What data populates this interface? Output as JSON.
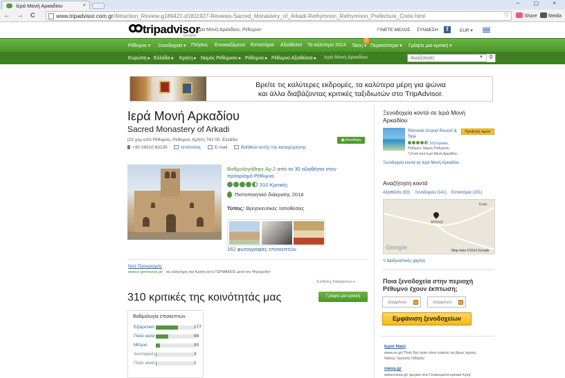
{
  "browser": {
    "tab_title": "Ιερά Μονή Αρκαδίου",
    "tab_close": "×",
    "url_host": "www.tripadvisor.com.gr",
    "url_path": "/Attraction_Review-g189421-d1811927-Reviews-Sacred_Monastery_of_Arkadi-Rethymnon_Rethymnon_Prefecture_Crete.html",
    "ext_share": "Share",
    "ext_media": "Media",
    "back": "←",
    "forward": "→",
    "reload": "C",
    "bookmark_star": "☆",
    "window_controls": "– ▢ ×"
  },
  "header": {
    "logo": "tripadvisor",
    "logo_sub": "Ελλάδα",
    "caption": "Ιερά Μονή Αρκαδίου, Ρέθυμνο",
    "join": "ΓΙΝΕΤΕ ΜΕΛΟΣ",
    "login": "ΣΥΝΔΕΣΗ",
    "fb": "f",
    "currency": "EUR ▾"
  },
  "nav": {
    "items": [
      "Ρέθυμνο ▾",
      "Ξενοδοχεία ▾",
      "Πτήσεις",
      "Ενοικιαζόμενα",
      "Εστιατόρια",
      "Αξιοθέατα",
      "Τα καλύτερα 2014",
      "Τάση ▾",
      "Περισσότερα ▾",
      "Γράψτε μια κριτική ▾"
    ],
    "badge": "2"
  },
  "breadcrumb": {
    "items": [
      "Ευρώπη ▸",
      "Ελλάδα ▸",
      "Κρήτη ▸",
      "Νομός Ρεθύμνου ▸",
      "Ρέθυμνο ▸",
      "Ρέθυμνο Αξιοθέατα ▸",
      "Ιερά Μονή Αρκαδίου"
    ],
    "search_placeholder": "Αναζήτηση",
    "search_icon": "⚲"
  },
  "banner": {
    "line1": "Βρείτε τις καλύτερες εκδρομές, τα καλύτερα μέρη για ψώνια",
    "line2": "και άλλα διαβάζοντας  κριτικές ταξιδιωτών στο TripAdvisor."
  },
  "attraction": {
    "title": "Ιερά Μονή Αρκαδίου",
    "subtitle": "Sacred Monastery of Arkadi",
    "address": "|23 χλμ από Ρέθυμνο, Ρέθυμνο, Κρήτη 741 00, Ελλάδα",
    "phone": "+30 28310 83135",
    "website": "Ιστότοπος",
    "email": "E-mail",
    "improve": "Βοήθεια αυτής της καταχώρησης",
    "save": "Αποθήκη",
    "ranked_pre": "Βαθμολογήθηκε Αρ.2",
    "ranked_mid": " από ",
    "ranked_link": "τα 30 αξιοθέατα στον προορισμό Ρέθυμνο",
    "rating": 4.5,
    "reviews_link": "310 Κριτικές",
    "certificate": "Πιστοποιητικό διάκρισης 2014",
    "type_label": "Τύπος:",
    "type_value": "Θρησκευτικές τοποθεσίες",
    "photos_link": "162 φωτογραφίες επισκεπτών"
  },
  "ad": {
    "title": "Νο1 Προορισμός",
    "url": "www.e-germanos.gr/",
    "text": "σε ολόκληρη την Κρήτη αν'α ΓΕΡΜΑΝΟΣ μετά τον Ψηλορείτη!",
    "footer": "Συνδέσεις διαφημίσεων ▸"
  },
  "reviews": {
    "heading": "310 κριτικές της κοινότητάς μας",
    "write_button": "Γράψτε μια κριτική",
    "ratings_title": "Βαθμολογία επισκεπτών",
    "rows": [
      {
        "label": "Εξαιρετικό",
        "count": "177",
        "share": 0.57
      },
      {
        "label": "Πολύ καλό",
        "count": "99",
        "share": 0.32
      },
      {
        "label": "Μέτριο",
        "count": "30",
        "share": 0.1
      },
      {
        "label": "Ανεπαρκές",
        "count": "3",
        "share": 0.01
      },
      {
        "label": "Πολύ κακό",
        "count": "1",
        "share": 0.003
      }
    ]
  },
  "sidebar": {
    "hotels_heading": "Ξενοδοχεία κοντά σε Ιερά Μονή Αρκαδίου",
    "hotel_name": "Rimondi Grand Resort & Spa",
    "hotel_deal": "Προβολή τιμών",
    "hotel_reviews": "163 Κριτικές",
    "hotel_location": "Ρέθυμνο, Νομός Ρεθύμνου",
    "hotel_distance": "7,8 km από Ιερά Μονή Αρκαδίου",
    "hotels_link": "Ξενοδοχεία κοντά σε Ιερά Μονή Αρκαδίου",
    "nearby_heading": "Αναζήτηση κοντά",
    "nearby_attractions": "Αξιοθέατα (83)",
    "nearby_hotels": "Ξενοδοχεία (141)",
    "nearby_restaurants": "Εστιατόρια (201)",
    "map_label": "ΑΡΚΑΔΙ",
    "map_place": "Εκάρ",
    "map_google": "Google",
    "map_copy": "Map data ©2014 Google",
    "map_link": "Διαδραστικός χάρτης",
    "question": "Ποια ξενοδοχεία στην περιοχή Ρέθυμνο έχουν έκπτωση;",
    "checkin": "ηη/μμ/εεεε",
    "checkout": "ηη/μμ/εεεε",
    "show_button": "Εμφάνιση ξενοδοχείων",
    "ad1_title": "Ιεροί Ναοί",
    "ad1_text": "www.xo.gr/  Ποτέ δεν ήταν τόσο εύκολο να βρεις Ιερούς Ναούς 'Χρυσός Οδηγός'",
    "ad2_title": "mexa.gr",
    "ad2_text": "www.mexa.gr/  ψυγεία στα Γενικευμένα κριτικά Κρητ"
  },
  "colors": {
    "brand_green": "#589442",
    "nav_green": "#4b962a",
    "link": "#2a62a6"
  }
}
